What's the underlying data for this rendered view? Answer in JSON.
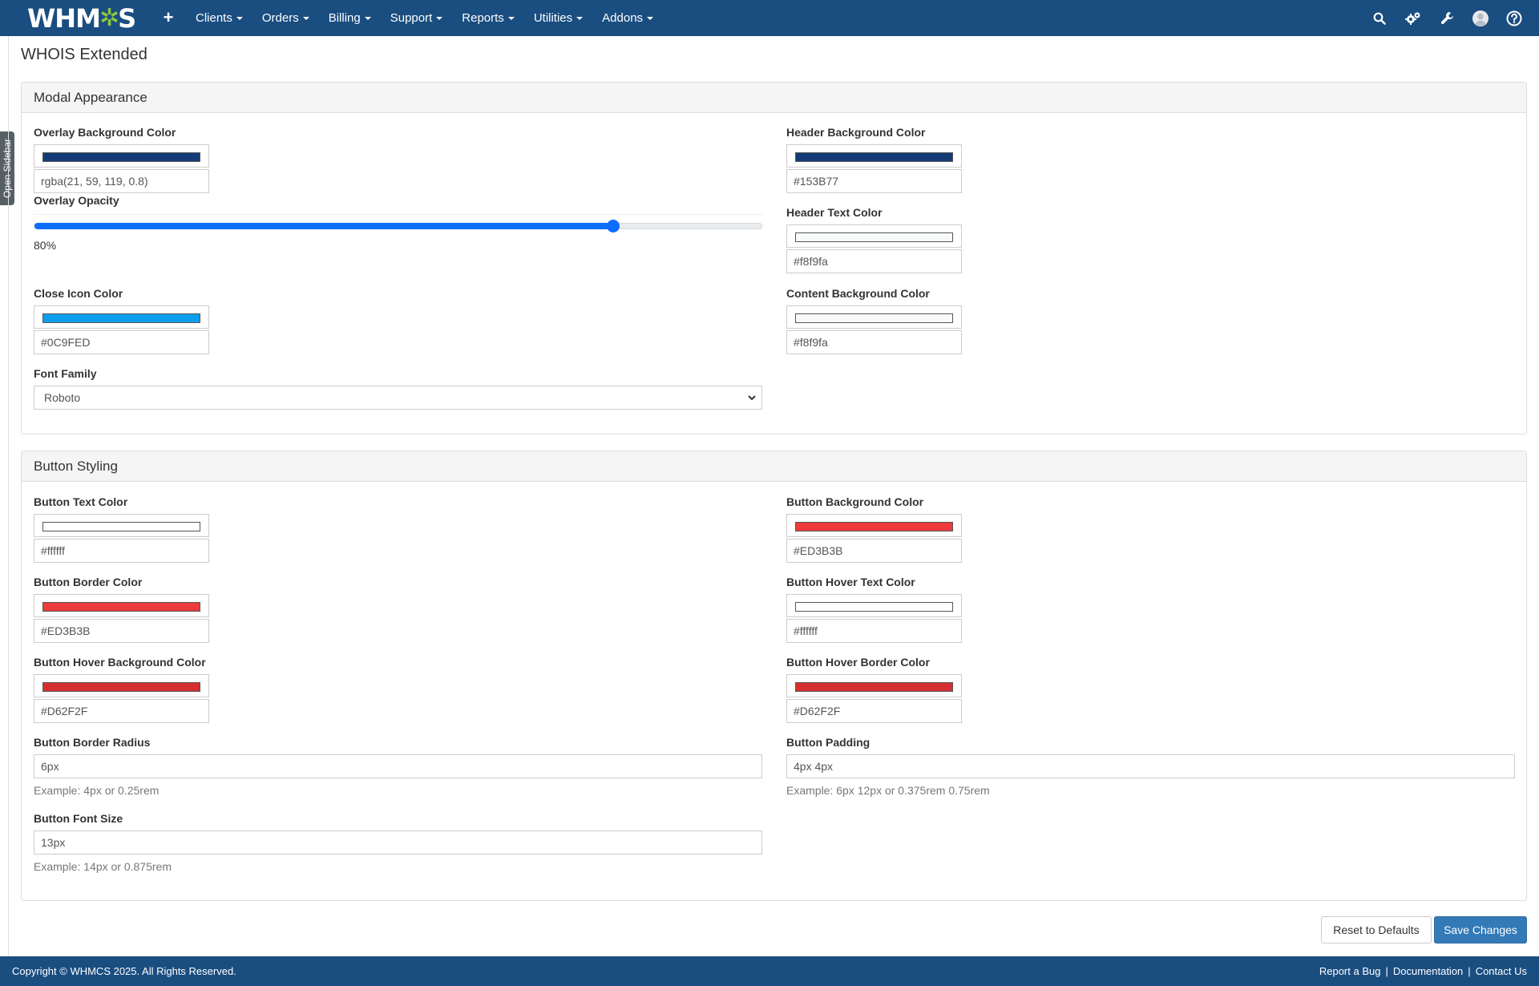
{
  "nav": {
    "logo_prefix": "WHM",
    "logo_gear": "✲",
    "logo_suffix": "S",
    "plus_label": "+",
    "menu": [
      "Clients",
      "Orders",
      "Billing",
      "Support",
      "Reports",
      "Utilities",
      "Addons"
    ],
    "icons": [
      "search-icon",
      "gears-icon",
      "wrench-icon",
      "user-avatar-icon",
      "help-icon"
    ]
  },
  "sidebar_tab": "Open Sidebar",
  "page_title": "WHOIS Extended",
  "modal": {
    "heading": "Modal Appearance",
    "overlay_bg": {
      "label": "Overlay Background Color",
      "color": "#153B77",
      "value": "rgba(21, 59, 119, 0.8)"
    },
    "opacity": {
      "label": "Overlay Opacity",
      "value": 80,
      "display": "80%"
    },
    "close_icon": {
      "label": "Close Icon Color",
      "color": "#0C9FED",
      "value": "#0C9FED"
    },
    "font_family": {
      "label": "Font Family",
      "value": "Roboto"
    },
    "header_bg": {
      "label": "Header Background Color",
      "color": "#153B77",
      "value": "#153B77"
    },
    "header_text": {
      "label": "Header Text Color",
      "color": "#f8f9fa",
      "value": "#f8f9fa"
    },
    "content_bg": {
      "label": "Content Background Color",
      "color": "#f8f9fa",
      "value": "#f8f9fa"
    }
  },
  "buttons": {
    "heading": "Button Styling",
    "text_color": {
      "label": "Button Text Color",
      "color": "#ffffff",
      "value": "#ffffff"
    },
    "border_color": {
      "label": "Button Border Color",
      "color": "#ED3B3B",
      "value": "#ED3B3B"
    },
    "hover_bg": {
      "label": "Button Hover Background Color",
      "color": "#D62F2F",
      "value": "#D62F2F"
    },
    "bg_color": {
      "label": "Button Background Color",
      "color": "#ED3B3B",
      "value": "#ED3B3B"
    },
    "hover_text": {
      "label": "Button Hover Text Color",
      "color": "#ffffff",
      "value": "#ffffff"
    },
    "hover_border": {
      "label": "Button Hover Border Color",
      "color": "#D62F2F",
      "value": "#D62F2F"
    },
    "radius": {
      "label": "Button Border Radius",
      "value": "6px",
      "help": "Example: 4px or 0.25rem"
    },
    "padding": {
      "label": "Button Padding",
      "value": "4px 4px",
      "help": "Example: 6px 12px or 0.375rem 0.75rem"
    },
    "font_size": {
      "label": "Button Font Size",
      "value": "13px",
      "help": "Example: 14px or 0.875rem"
    }
  },
  "actions": {
    "reset": "Reset to Defaults",
    "save": "Save Changes"
  },
  "footer": {
    "copyright": "Copyright © WHMCS 2025. All Rights Reserved.",
    "links": [
      "Report a Bug",
      "Documentation",
      "Contact Us"
    ],
    "separator": "|"
  },
  "colors": {
    "nav_bg": "#1a4d80",
    "slider": "#0d6efd",
    "primary_button": "#337ab7",
    "logo_gear": "#8fc640"
  }
}
